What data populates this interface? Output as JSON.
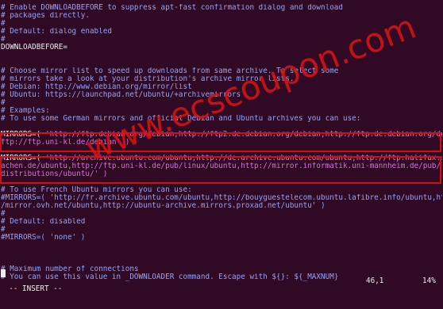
{
  "editor": {
    "lines": [
      {
        "type": "comment",
        "text": "# Enable DOWNLOADBEFORE to suppress apt-fast confirmation dialog and download"
      },
      {
        "type": "comment",
        "text": "# packages directly."
      },
      {
        "type": "comment",
        "text": "#"
      },
      {
        "type": "comment",
        "text": "# Default: dialog enabled"
      },
      {
        "type": "comment",
        "text": "#"
      },
      {
        "type": "code",
        "text": "DOWNLOADBEFORE="
      },
      {
        "type": "blank",
        "text": ""
      },
      {
        "type": "blank",
        "text": ""
      },
      {
        "type": "comment",
        "text": "# Choose mirror list to speed up downloads from same archive. To select some"
      },
      {
        "type": "comment",
        "text": "# mirrors take a look at your distribution's archive mirror lists."
      },
      {
        "type": "comment",
        "text": "# Debian: http://www.debian.org/mirror/list"
      },
      {
        "type": "comment",
        "text": "# Ubuntu: https://launchpad.net/ubuntu/+archivemirrors"
      },
      {
        "type": "comment",
        "text": "#"
      },
      {
        "type": "comment",
        "text": "# Examples:"
      },
      {
        "type": "comment",
        "text": "# To use some German mirrors and official Debian and Ubuntu archives you can use:"
      },
      {
        "type": "blank",
        "text": ""
      },
      {
        "type": "mirror",
        "key": "MIRRORS=(",
        "text": " 'http://ftp.debian.org/debian,http://ftp2.de.debian.org/debian,http://ftp.de.debian.org/debian,"
      },
      {
        "type": "str",
        "text": "ftp://ftp.uni-kl.de/debian' )"
      },
      {
        "type": "blank",
        "text": ""
      },
      {
        "type": "mirror",
        "key": "MIRRORS=(",
        "text": " 'http://archive.ubuntu.com/ubuntu,http://de.archive.ubuntu.com/ubuntu,http://ftp.halifax.rwth-a"
      },
      {
        "type": "str",
        "text": "achen.de/ubuntu,http://ftp.uni-kl.de/pub/linux/ubuntu,http://mirror.informatik.uni-mannheim.de/pub/linux/"
      },
      {
        "type": "str",
        "text": "distributions/ubuntu/' )"
      },
      {
        "type": "blank",
        "text": ""
      },
      {
        "type": "comment",
        "text": "# To use French Ubuntu mirrors you can use:"
      },
      {
        "type": "comment",
        "text": "#MIRRORS=( 'http://fr.archive.ubuntu.com/ubuntu,http://bouyguestelecom.ubuntu.lafibre.info/ubuntu,http://"
      },
      {
        "type": "comment",
        "text": "/mirror.ovh.net/ubuntu,http://ubuntu-archive.mirrors.proxad.net/ubuntu' )"
      },
      {
        "type": "comment",
        "text": "#"
      },
      {
        "type": "comment",
        "text": "# Default: disabled"
      },
      {
        "type": "comment",
        "text": "#"
      },
      {
        "type": "comment",
        "text": "#MIRRORS=( 'none' )"
      },
      {
        "type": "blank",
        "text": ""
      },
      {
        "type": "blank",
        "text": ""
      },
      {
        "type": "blank",
        "text": ""
      },
      {
        "type": "comment",
        "text": "# Maximum number of connections"
      },
      {
        "type": "comment",
        "text": "# You can use this value in _DOWNLOADER command. Escape with ${}: ${_MAXNUM}"
      }
    ]
  },
  "status": {
    "mode": "-- INSERT --",
    "position": "46,1",
    "percent": "14%"
  },
  "watermark": "www.ecscoupon.com",
  "colors": {
    "background": "#300a24",
    "comment": "#8fa3ff",
    "string": "#d870d8",
    "highlight": "#d01010"
  }
}
